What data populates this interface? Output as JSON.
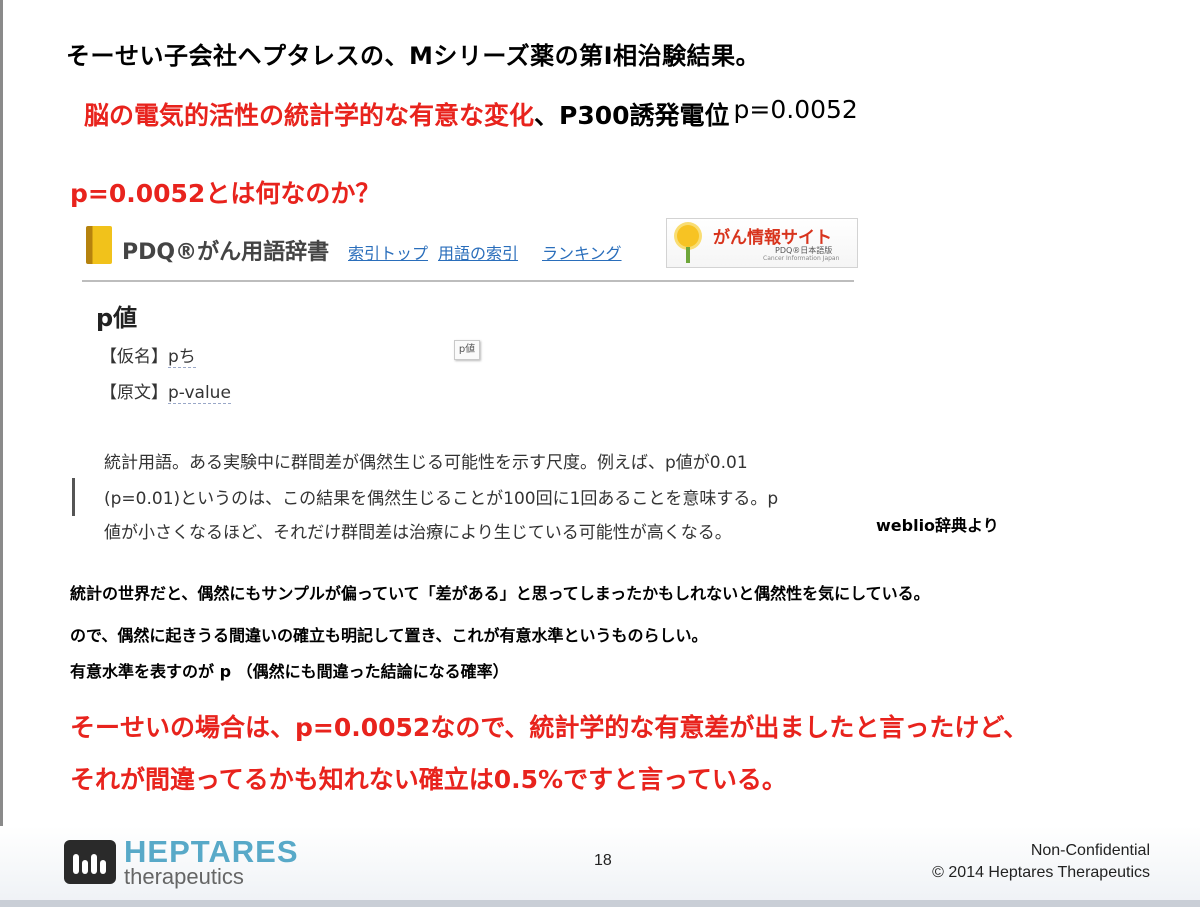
{
  "slide": {
    "title": "そーせい子会社ヘプタレスの、Mシリーズ薬の第Ⅰ相治験結果。",
    "headline_red": "脳の電気的活性の統計学的な有意な変化",
    "headline_black": "、P300誘発電位",
    "headline_pvalue": "p=0.0052",
    "question": "p=0.0052とは何なのか？",
    "source_note": "weblio辞典より",
    "body_lines": [
      "統計の世界だと、偶然にもサンプルが偏っていて「差がある」と思ってしまったかもしれないと偶然性を気にしている。",
      "ので、偶然に起きうる間違いの確立も明記して置き、これが有意水準というものらしい。",
      "有意水準を表すのが p （偶然にも間違った結論になる確率）"
    ],
    "conclusion_lines": [
      "そーせいの場合は、p=0.0052なので、統計学的な有意差が出ましたと言ったけど、",
      "それが間違ってるかも知れない確立は0.5%ですと言っている。"
    ]
  },
  "dictionary": {
    "name": "PDQ®がん用語辞書",
    "nav": [
      "索引トップ",
      "用語の索引",
      "ランキング"
    ],
    "banner_title": "がん情報サイト",
    "banner_sub": "PDQ®日本語版",
    "banner_tiny": "Cancer Information Japan",
    "term": "p値",
    "kana_label": "【仮名】",
    "kana_value": "pち",
    "orig_label": "【原文】",
    "orig_value": "p-value",
    "image_label": "p値",
    "definition_lines": [
      "統計用語。ある実験中に群間差が偶然生じる可能性を示す尺度。例えば、p値が0.01",
      "(p=0.01)というのは、この結果を偶然生じることが100回に1回あることを意味する。p",
      "値が小さくなるほど、それだけ群間差は治療により生じている可能性が高くなる。"
    ]
  },
  "footer": {
    "brand": "HEPTARES",
    "brand_sub": "therapeutics",
    "page_number": "18",
    "confidentiality": "Non-Confidential",
    "copyright": "© 2014 Heptares Therapeutics"
  },
  "colors": {
    "accent_red": "#e8231d",
    "brand_blue": "#58a9c8",
    "link_blue": "#2a6ebb"
  }
}
